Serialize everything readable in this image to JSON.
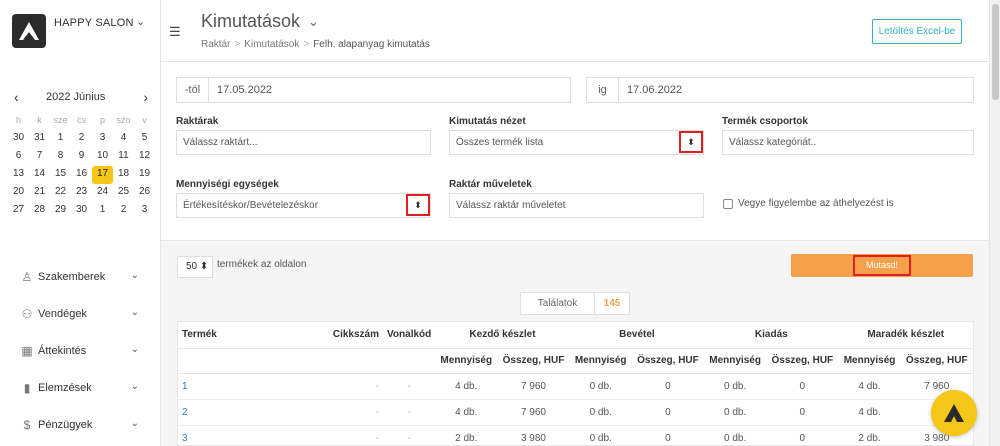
{
  "brand": {
    "name": "HAPPY SALON",
    "chevron": "⌄"
  },
  "calendar": {
    "title": "2022 Június",
    "prev": "‹",
    "next": "›",
    "dow": [
      "h",
      "k",
      "sze",
      "cs",
      "p",
      "szo",
      "v"
    ],
    "weeks": [
      [
        "30",
        "31",
        "1",
        "2",
        "3",
        "4",
        "5"
      ],
      [
        "6",
        "7",
        "8",
        "9",
        "10",
        "11",
        "12"
      ],
      [
        "13",
        "14",
        "15",
        "16",
        "17",
        "18",
        "19"
      ],
      [
        "20",
        "21",
        "22",
        "23",
        "24",
        "25",
        "26"
      ],
      [
        "27",
        "28",
        "29",
        "30",
        "1",
        "2",
        "3"
      ]
    ],
    "today": "17"
  },
  "nav": [
    {
      "label": "Szakemberek",
      "icon": "user-icon"
    },
    {
      "label": "Vendégek",
      "icon": "users-icon"
    },
    {
      "label": "Áttekintés",
      "icon": "grid-icon"
    },
    {
      "label": "Elemzések",
      "icon": "chart-icon"
    },
    {
      "label": "Pénzügyek",
      "icon": "dollar-icon"
    }
  ],
  "header": {
    "title": "Kimutatások",
    "breadcrumb": [
      "Raktár",
      "Kimutatások",
      "Felh. alapanyag kimutatás"
    ],
    "excel_button": "Letöltés Excel-be"
  },
  "filters": {
    "from_prefix": "-tól",
    "from_value": "17.05.2022",
    "to_prefix": "ig",
    "to_value": "17.06.2022",
    "warehouses_label": "Raktárak",
    "warehouses_placeholder": "Válassz raktárt...",
    "view_label": "Kimutatás nézet",
    "view_value": "Összes termék lista",
    "groups_label": "Termék csoportok",
    "groups_placeholder": "Válassz kategóriát..",
    "units_label": "Mennyiségi egységek",
    "units_value": "Értékesítéskor/Bevételezéskor",
    "ops_label": "Raktár műveletek",
    "ops_placeholder": "Válassz raktár műveletet",
    "transfer_label": "Vegye figyelembe az áthelyezést is",
    "select_arrows": "⬍"
  },
  "controls": {
    "per_page": "50",
    "per_page_label": "termékek az oldalon",
    "show_button": "Mutasd!"
  },
  "results": {
    "label": "Találatok",
    "count": "145"
  },
  "table": {
    "headers": [
      "Termék",
      "Cikkszám",
      "Vonalkód",
      "Kezdő készlet",
      "Bevétel",
      "Kiadás",
      "Maradék készlet"
    ],
    "subheaders": [
      "Mennyiség",
      "Összeg, HUF",
      "Mennyiség",
      "Összeg, HUF",
      "Mennyiség",
      "Összeg, HUF",
      "Mennyiség",
      "Összeg, HUF"
    ],
    "rows": [
      [
        "1",
        "-",
        "-",
        "4 db.",
        "7 960",
        "0 db.",
        "0",
        "0 db.",
        "0",
        "4 db.",
        "7 960"
      ],
      [
        "2",
        "-",
        "-",
        "4 db.",
        "7 960",
        "0 db.",
        "0",
        "0 db.",
        "0",
        "4 db.",
        "7"
      ],
      [
        "3",
        "-",
        "-",
        "2 db.",
        "3 980",
        "0 db.",
        "0",
        "0 db.",
        "0",
        "2 db.",
        "3 980"
      ]
    ]
  },
  "colors": {
    "accent": "#f5a04a",
    "teal": "#2bb3c0",
    "today": "#f5c518",
    "highlight": "#e02020"
  }
}
